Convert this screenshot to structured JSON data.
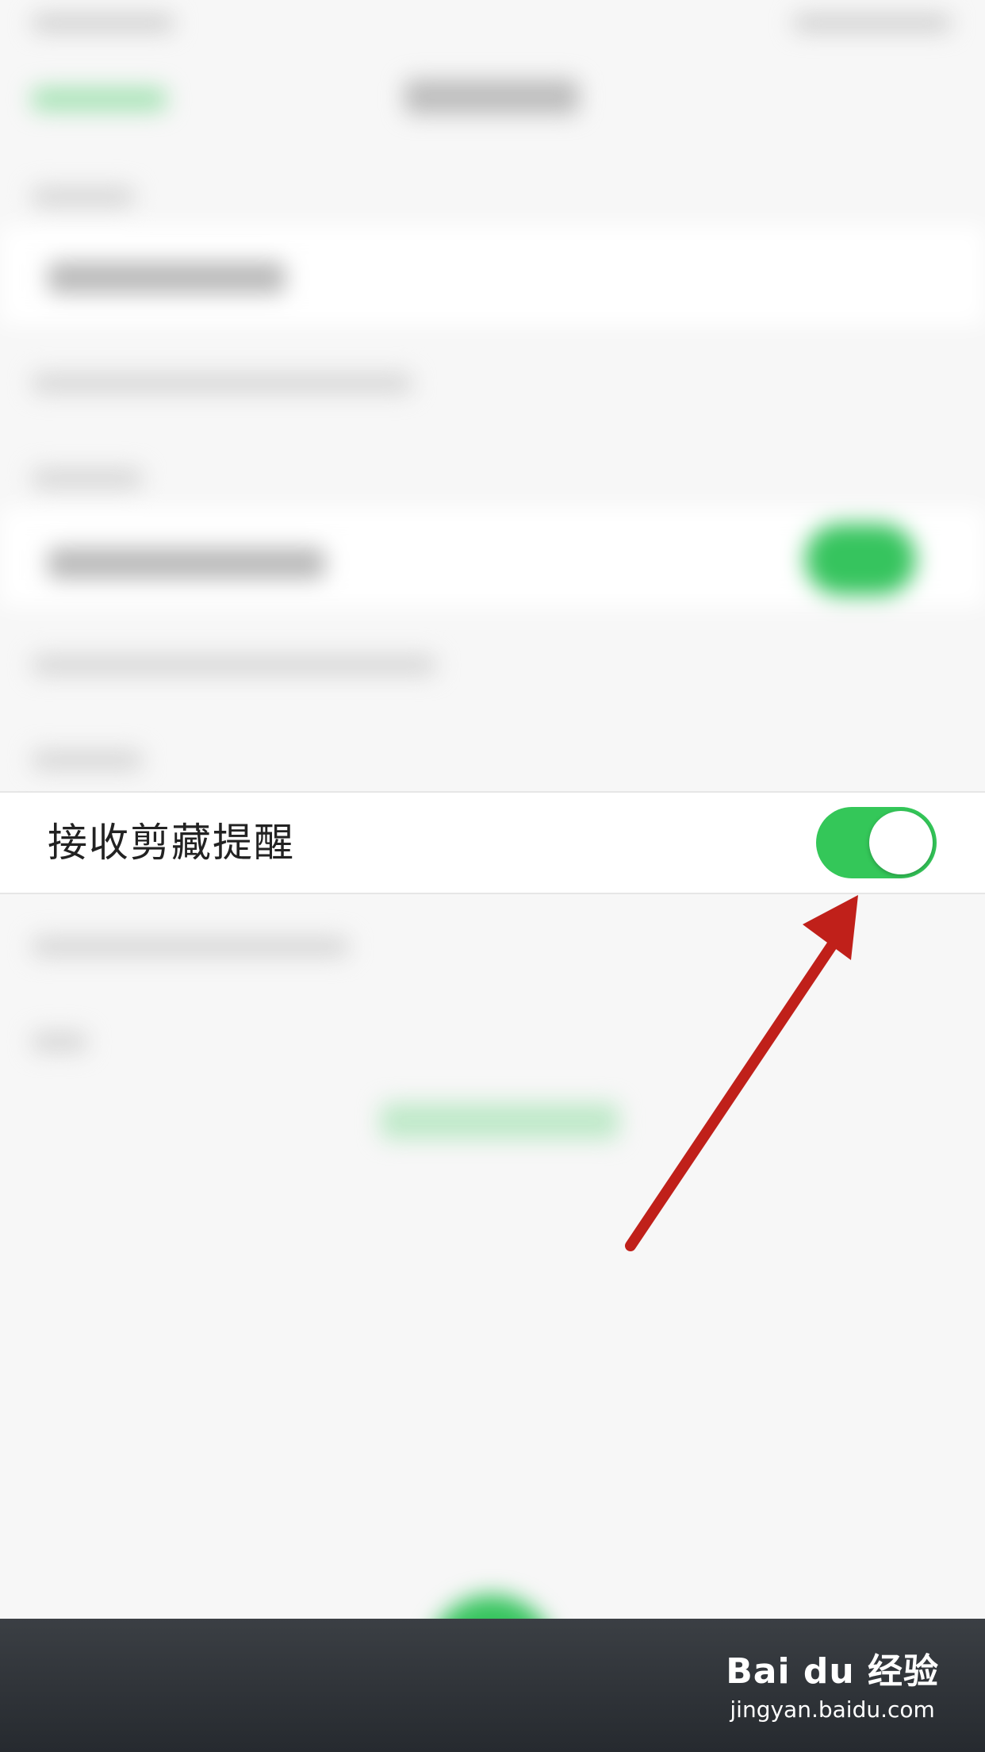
{
  "settings": {
    "focus_row": {
      "label": "接收剪藏提醒",
      "toggle_on": true
    }
  },
  "colors": {
    "toggle_on": "#34c759",
    "arrow": "#c0201a",
    "background": "#f7f7f7"
  },
  "watermark": {
    "logo": "Bai du 经验",
    "url": "jingyan.baidu.com"
  }
}
